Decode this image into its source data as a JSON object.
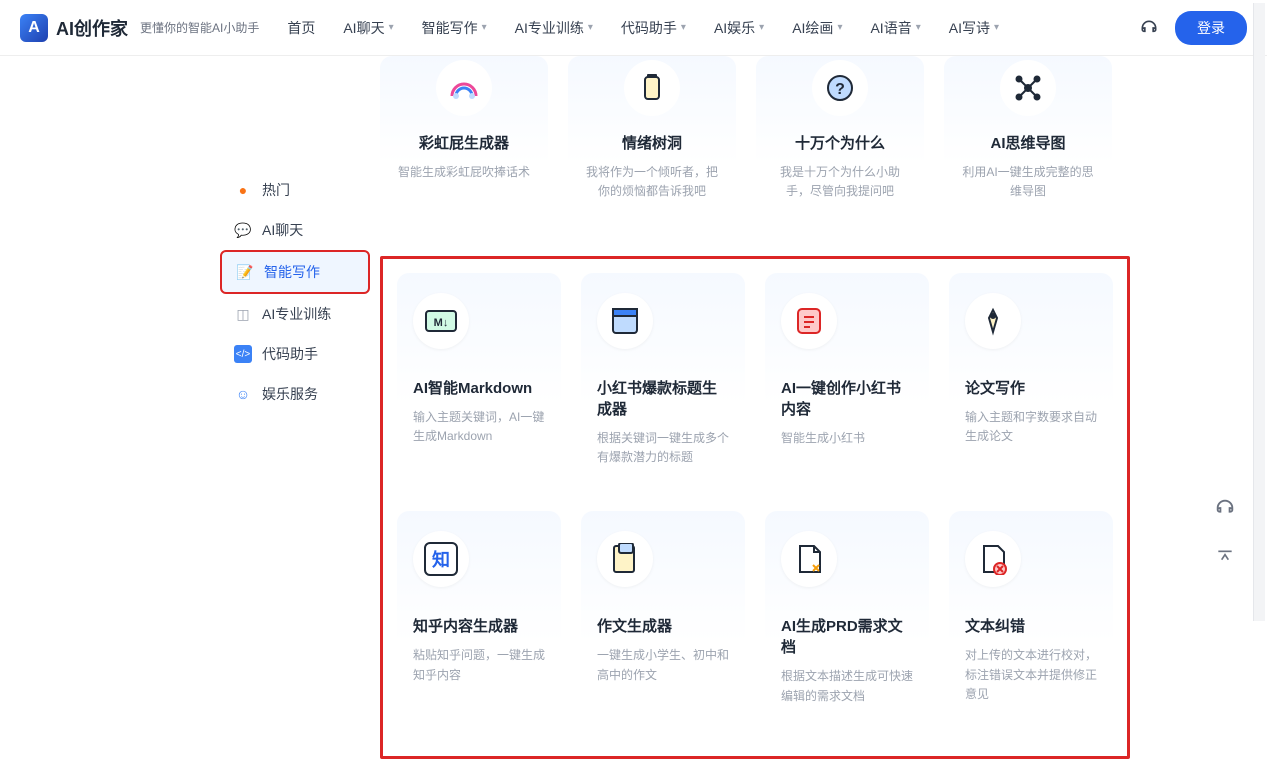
{
  "header": {
    "logo_text": "AI创作家",
    "tagline": "更懂你的智能AI小助手",
    "nav": [
      {
        "label": "首页",
        "dropdown": false
      },
      {
        "label": "AI聊天",
        "dropdown": true
      },
      {
        "label": "智能写作",
        "dropdown": true
      },
      {
        "label": "AI专业训练",
        "dropdown": true
      },
      {
        "label": "代码助手",
        "dropdown": true
      },
      {
        "label": "AI娱乐",
        "dropdown": true
      },
      {
        "label": "AI绘画",
        "dropdown": true
      },
      {
        "label": "AI语音",
        "dropdown": true
      },
      {
        "label": "AI写诗",
        "dropdown": true
      }
    ],
    "login": "登录"
  },
  "sidebar": {
    "items": [
      {
        "icon": "fire",
        "label": "热门",
        "color": "#f97316"
      },
      {
        "icon": "chat",
        "label": "AI聊天",
        "color": "#3b82f6"
      },
      {
        "icon": "edit",
        "label": "智能写作",
        "color": "#2563eb",
        "active": true
      },
      {
        "icon": "cube",
        "label": "AI专业训练",
        "color": "#6b7280"
      },
      {
        "icon": "code",
        "label": "代码助手",
        "color": "#3b82f6"
      },
      {
        "icon": "smile",
        "label": "娱乐服务",
        "color": "#3b82f6"
      }
    ]
  },
  "top_cards": [
    {
      "icon": "rainbow",
      "title": "彩虹屁生成器",
      "desc": "智能生成彩虹屁吹捧话术"
    },
    {
      "icon": "jar",
      "title": "情绪树洞",
      "desc": "我将作为一个倾听者，把你的烦恼都告诉我吧"
    },
    {
      "icon": "question",
      "title": "十万个为什么",
      "desc": "我是十万个为什么小助手，尽管向我提问吧"
    },
    {
      "icon": "mindmap",
      "title": "AI思维导图",
      "desc": "利用AI一键生成完整的思维导图"
    }
  ],
  "grid_cards": [
    {
      "icon": "markdown",
      "title": "AI智能Markdown",
      "desc": "输入主题关键词，AI一键生成Markdown"
    },
    {
      "icon": "window",
      "title": "小红书爆款标题生成器",
      "desc": "根据关键词一键生成多个有爆款潜力的标题"
    },
    {
      "icon": "note",
      "title": "AI一键创作小红书内容",
      "desc": "智能生成小红书"
    },
    {
      "icon": "pen",
      "title": "论文写作",
      "desc": "输入主题和字数要求自动生成论文"
    },
    {
      "icon": "zhi",
      "title": "知乎内容生成器",
      "desc": "粘贴知乎问题，一键生成知乎内容"
    },
    {
      "icon": "doc",
      "title": "作文生成器",
      "desc": "一键生成小学生、初中和高中的作文"
    },
    {
      "icon": "prd",
      "title": "AI生成PRD需求文档",
      "desc": "根据文本描述生成可快速编辑的需求文档"
    },
    {
      "icon": "check",
      "title": "文本纠错",
      "desc": "对上传的文本进行校对，标注错误文本并提供修正意见"
    }
  ]
}
